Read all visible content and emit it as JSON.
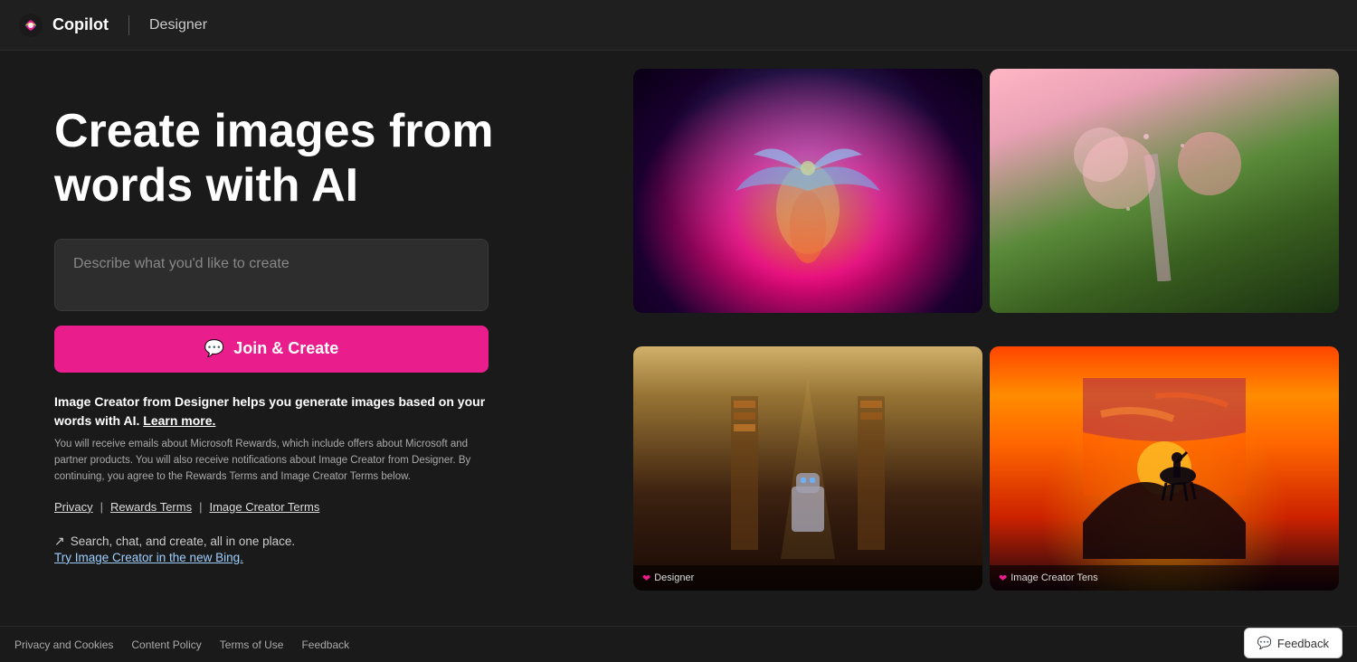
{
  "header": {
    "logo_alt": "Copilot logo",
    "app_name": "Copilot",
    "product_name": "Designer"
  },
  "hero": {
    "title_line1": "Create images from",
    "title_line2": "words with AI"
  },
  "input": {
    "placeholder": "Describe what you'd like to create"
  },
  "buttons": {
    "join_create": "Join & Create"
  },
  "description": {
    "bold_text": "Image Creator from Designer helps you generate images based on your words with AI.",
    "learn_more": "Learn more.",
    "fine_print": "You will receive emails about Microsoft Rewards, which include offers about Microsoft and partner products. You will also receive notifications about Image Creator from Designer. By continuing, you agree to the Rewards Terms and Image Creator Terms below."
  },
  "terms": {
    "privacy": "Privacy",
    "rewards": "Rewards Terms",
    "image_creator": "Image Creator Terms"
  },
  "bing_promo": {
    "line1": "Search, chat, and create, all in one place.",
    "link_text": "Try Image Creator in the new Bing."
  },
  "footer": {
    "privacy_cookies": "Privacy and Cookies",
    "content_policy": "Content Policy",
    "terms_of_use": "Terms of Use",
    "feedback": "Feedback"
  },
  "images": {
    "bottom_label1": "Designer",
    "bottom_label2": "Image Creator Tens"
  }
}
